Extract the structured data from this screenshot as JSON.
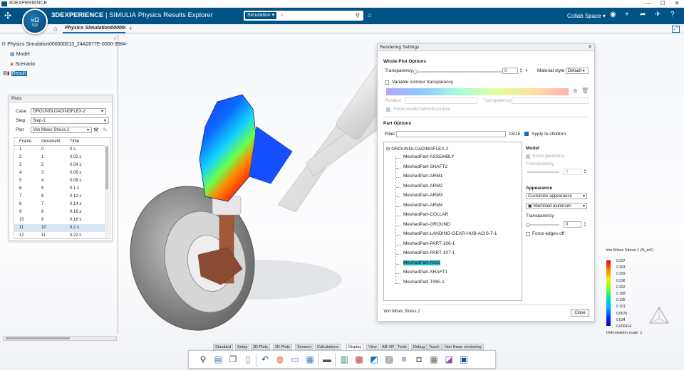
{
  "window": {
    "title": "3DEXPERIENCE",
    "controls": [
      "—",
      "☐",
      "✕"
    ]
  },
  "topbar": {
    "logo_icon": "ds-logo-icon",
    "compass": {
      "top": "»Ω",
      "version": "V,R"
    },
    "brand_bold": "3DEXPERIENCE",
    "brand_light": " | SIMULIA",
    "app_name": "Physics Results Explorer",
    "search_scope": "Simulation",
    "search_value": "n",
    "search_icon": "search-icon",
    "collab_space": "Collab Space",
    "icons": [
      "user-icon",
      "add-icon",
      "share-icon",
      "communicate-icon",
      "help-icon"
    ]
  },
  "tabbar": {
    "tab_label": "Physics Simulation000000",
    "add": "+"
  },
  "tree": {
    "root": "Physics Simulation000000013_24A2877E-0000-3584-",
    "items": [
      "Model",
      "Scenario",
      "Result"
    ]
  },
  "plots_panel": {
    "title": "Plots",
    "case_label": "Case",
    "case_value": "GROUNDLOADINGFLEX-2",
    "step_label": "Step",
    "step_value": "Step-1",
    "plot_label": "Plot",
    "plot_value": "Von Mises Stress.1",
    "columns": [
      "Frame",
      "Increment",
      "Time"
    ],
    "rows": [
      [
        "1",
        "0",
        "0 s"
      ],
      [
        "2",
        "1",
        "0.02 s"
      ],
      [
        "3",
        "2",
        "0.04 s"
      ],
      [
        "4",
        "3",
        "0.06 s"
      ],
      [
        "5",
        "4",
        "0.08 s"
      ],
      [
        "6",
        "5",
        "0.1 s"
      ],
      [
        "7",
        "6",
        "0.12 s"
      ],
      [
        "8",
        "7",
        "0.14 s"
      ],
      [
        "9",
        "8",
        "0.16 s"
      ],
      [
        "10",
        "9",
        "0.18 s"
      ],
      [
        "11",
        "10",
        "0.2 s"
      ],
      [
        "12",
        "11",
        "0.22 s"
      ]
    ],
    "selected_row": 10
  },
  "rendering": {
    "title": "Rendering Settings",
    "whole_title": "Whole Plot Options",
    "transparency_label": "Transparency",
    "transparency_value": "0",
    "material_label": "Material style",
    "material_value": "Default",
    "variable_label": "Variable contour transparency",
    "position_label": "Position",
    "transparency2_label": "Transparency",
    "show_behind": "Show model behind contour",
    "part_title": "Part Options",
    "filter_label": "Filter",
    "filter_count": "15/15",
    "apply_children": "Apply to children",
    "tree_root": "GROUNDLOADINGFLEX-2",
    "parts": [
      "MeshedPart-ASSEMBLY",
      "MeshedPart-SHAFT2",
      "MeshedPart-ARM1",
      "MeshedPart-ARM2",
      "MeshedPart-ARM3",
      "MeshedPart-ARM4",
      "MeshedPart-COLLAR",
      "MeshedPart-GROUND",
      "MeshedPart-LANDING-GEAR-HUB-ACIS-7-1",
      "MeshedPart-PART-106-1",
      "MeshedPart-PART-107-1",
      "MeshedPart-ROD",
      "MeshedPart-SHAFT1",
      "MeshedPart-TIRE-1"
    ],
    "selected_part": 11,
    "model_title": "Model",
    "show_geometry": "Show geometry",
    "model_transparency_label": "Transparency",
    "model_transparency_value": "0",
    "appearance_title": "Appearance",
    "appearance_value": "Customize appearance",
    "appearance_material": "Machined aluminum",
    "app_transparency_label": "Transparency",
    "app_transparency_value": "0",
    "force_edges": "Force edges off",
    "footer": "Von Mises Stress.1",
    "close": "Close"
  },
  "legend": {
    "title": "Von Mises Stress.1 (N_m2)",
    "ticks": [
      "0.337",
      "0.303",
      "0.269",
      "0.236",
      "0.202",
      "0.168",
      "0.135",
      "0.101",
      "0.0676",
      "0.034",
      "0.000414"
    ],
    "deformation": "Deformation scale: 1"
  },
  "action_tabs": [
    "Standard",
    "Setup",
    "3D Plots",
    "2D Plots",
    "Sensors",
    "Calculations",
    "Display",
    "View",
    "AR-VR",
    "Tools",
    "Debug",
    "Touch",
    "Non linear versioning"
  ],
  "active_tab": "Display",
  "toolbar_icons": [
    "zoom-icon",
    "page-icon",
    "copy-icon",
    "paste-icon",
    "undo-icon",
    "sphere-icon",
    "screen-icon",
    "table-icon",
    "presentation-icon",
    "part-icon",
    "color-icon",
    "shading-icon",
    "image-icon",
    "layers-icon",
    "camera-icon",
    "grid-icon",
    "render-icon",
    "export-icon"
  ]
}
